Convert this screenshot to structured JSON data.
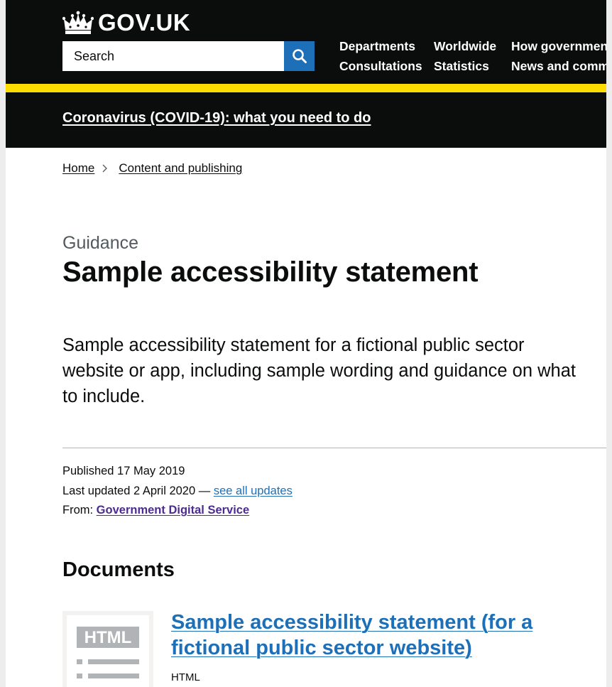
{
  "header": {
    "logo_text": "GOV.UK",
    "search_placeholder": "Search",
    "nav": [
      {
        "label": "Departments"
      },
      {
        "label": "Worldwide"
      },
      {
        "label": "How government works"
      },
      {
        "label": "Consultations"
      },
      {
        "label": "Statistics"
      },
      {
        "label": "News and communications"
      }
    ]
  },
  "banner": {
    "text": "Coronavirus (COVID-19): what you need to do"
  },
  "breadcrumb": [
    {
      "label": "Home"
    },
    {
      "label": "Content and publishing"
    }
  ],
  "page": {
    "caption": "Guidance",
    "title": "Sample accessibility statement",
    "lead": "Sample accessibility statement for a fictional public sector website or app, including sample wording and guidance on what to include."
  },
  "metadata": {
    "published": "Published 17 May 2019",
    "updated_prefix": "Last updated 2 April 2020 — ",
    "updated_link": "see all updates",
    "from_label": "From: ",
    "from_org": "Government Digital Service"
  },
  "documents": {
    "heading": "Documents",
    "items": [
      {
        "thumb_label": "HTML",
        "title": "Sample accessibility statement (for a fictional public sector website)",
        "type": "HTML"
      }
    ]
  },
  "colors": {
    "header_bg": "#0b0c0c",
    "accent_yellow": "#ffdd00",
    "link_blue": "#1d70b8",
    "org_purple": "#4c2c92"
  }
}
